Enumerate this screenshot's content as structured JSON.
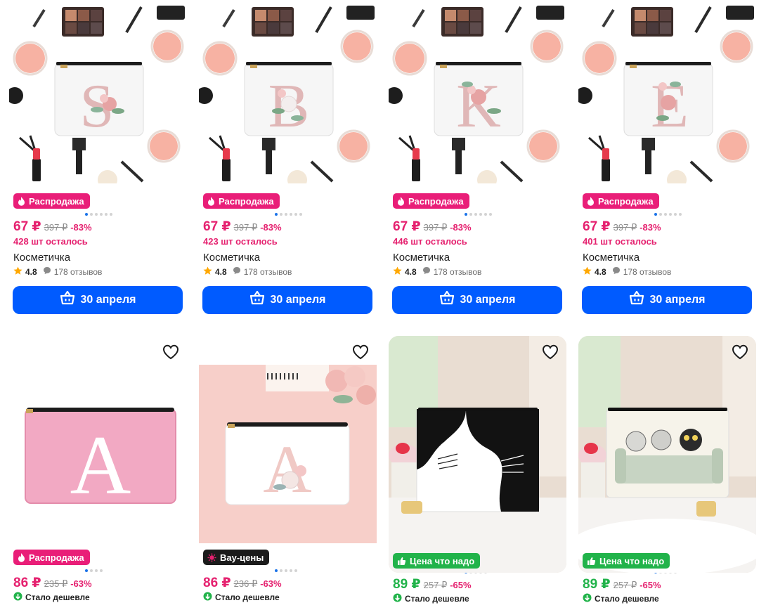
{
  "top_cards": [
    {
      "badge": "Распродажа",
      "price": "67 ₽",
      "old_price": "397 ₽",
      "discount": "-83%",
      "stock": "428 шт осталось",
      "title": "Косметичка",
      "rating": "4.8",
      "reviews": "178 отзывов",
      "button": "30 апреля",
      "letter": "S"
    },
    {
      "badge": "Распродажа",
      "price": "67 ₽",
      "old_price": "397 ₽",
      "discount": "-83%",
      "stock": "423 шт осталось",
      "title": "Косметичка",
      "rating": "4.8",
      "reviews": "178 отзывов",
      "button": "30 апреля",
      "letter": "B"
    },
    {
      "badge": "Распродажа",
      "price": "67 ₽",
      "old_price": "397 ₽",
      "discount": "-83%",
      "stock": "446 шт осталось",
      "title": "Косметичка",
      "rating": "4.8",
      "reviews": "178 отзывов",
      "button": "30 апреля",
      "letter": "K"
    },
    {
      "badge": "Распродажа",
      "price": "67 ₽",
      "old_price": "397 ₽",
      "discount": "-83%",
      "stock": "401 шт осталось",
      "title": "Косметичка",
      "rating": "4.8",
      "reviews": "178 отзывов",
      "button": "30 апреля",
      "letter": "E"
    }
  ],
  "bottom_cards": [
    {
      "badge": "Распродажа",
      "badge_kind": "sale",
      "price": "86 ₽",
      "old_price": "235 ₽",
      "discount": "-63%",
      "note": "Стало дешевле",
      "letter": "A",
      "price_color": "pink"
    },
    {
      "badge": "Вау-цены",
      "badge_kind": "wow",
      "price": "86 ₽",
      "old_price": "236 ₽",
      "discount": "-63%",
      "note": "Стало дешевле",
      "letter": "A",
      "price_color": "pink"
    },
    {
      "badge": "Цена что надо",
      "badge_kind": "fair",
      "price": "89 ₽",
      "old_price": "257 ₽",
      "discount": "-65%",
      "note": "Стало дешевле",
      "price_color": "green"
    },
    {
      "badge": "Цена что надо",
      "badge_kind": "fair",
      "price": "89 ₽",
      "old_price": "257 ₽",
      "discount": "-65%",
      "note": "Стало дешевле",
      "price_color": "green"
    }
  ],
  "colors": {
    "accent": "#005bff",
    "sale": "#e91e78",
    "fair": "#21b34a",
    "wow": "#1b1b1b"
  }
}
